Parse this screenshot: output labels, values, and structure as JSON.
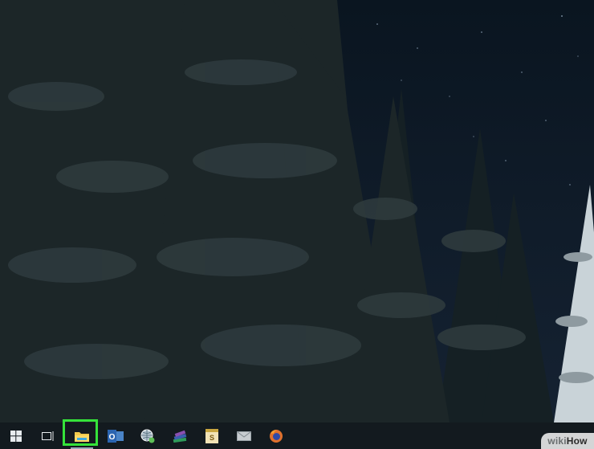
{
  "screen": {
    "background_sky": "#0d1a26",
    "tree_color": "#1e2a2c",
    "snow_color": "#dfe6ea"
  },
  "taskbar": {
    "background": "#131a1f",
    "items": [
      {
        "id": "start",
        "icon": "windows-logo-icon"
      },
      {
        "id": "task-view",
        "icon": "task-view-icon"
      },
      {
        "id": "file-explorer",
        "icon": "folder-icon",
        "highlighted": true,
        "running": true
      },
      {
        "id": "outlook",
        "icon": "outlook-icon",
        "letter": "O"
      },
      {
        "id": "network",
        "icon": "globe-network-icon"
      },
      {
        "id": "books",
        "icon": "books-icon"
      },
      {
        "id": "sway",
        "icon": "sway-icon",
        "letter": "S"
      },
      {
        "id": "mail",
        "icon": "mail-icon"
      },
      {
        "id": "firefox",
        "icon": "firefox-icon"
      }
    ],
    "highlight_color": "#35e33a"
  },
  "watermark": {
    "wiki": "wiki",
    "how": "How"
  }
}
